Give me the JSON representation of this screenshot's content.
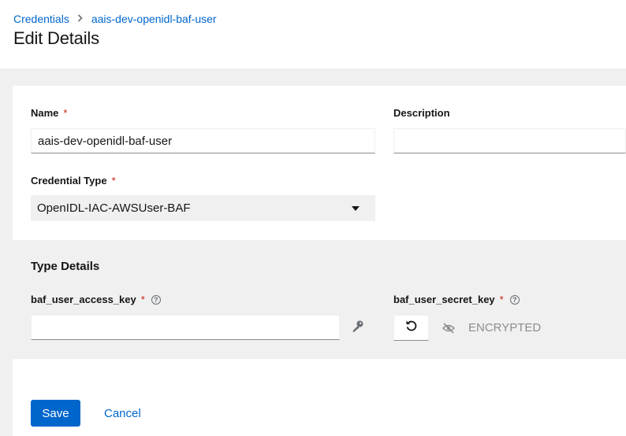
{
  "breadcrumb": {
    "parent": "Credentials",
    "current": "aais-dev-openidl-baf-user"
  },
  "page": {
    "title": "Edit Details"
  },
  "form": {
    "name": {
      "label": "Name",
      "required": "*",
      "value": "aais-dev-openidl-baf-user"
    },
    "description": {
      "label": "Description",
      "value": ""
    },
    "credential_type": {
      "label": "Credential Type",
      "required": "*",
      "selected": "OpenIDL-IAC-AWSUser-BAF"
    },
    "type_details": {
      "heading": "Type Details",
      "access_key": {
        "label": "baf_user_access_key",
        "required": "*",
        "help": "?",
        "value": "",
        "button_icon": "key-icon"
      },
      "secret_key": {
        "label": "baf_user_secret_key",
        "required": "*",
        "help": "?",
        "reset_icon": "undo-icon",
        "visibility_icon": "eye-slash-icon",
        "placeholder": "ENCRYPTED"
      }
    }
  },
  "actions": {
    "save": "Save",
    "cancel": "Cancel"
  },
  "colors": {
    "primary": "#0066cc",
    "required": "#c9190b",
    "muted_bg": "#f0f0f0"
  }
}
